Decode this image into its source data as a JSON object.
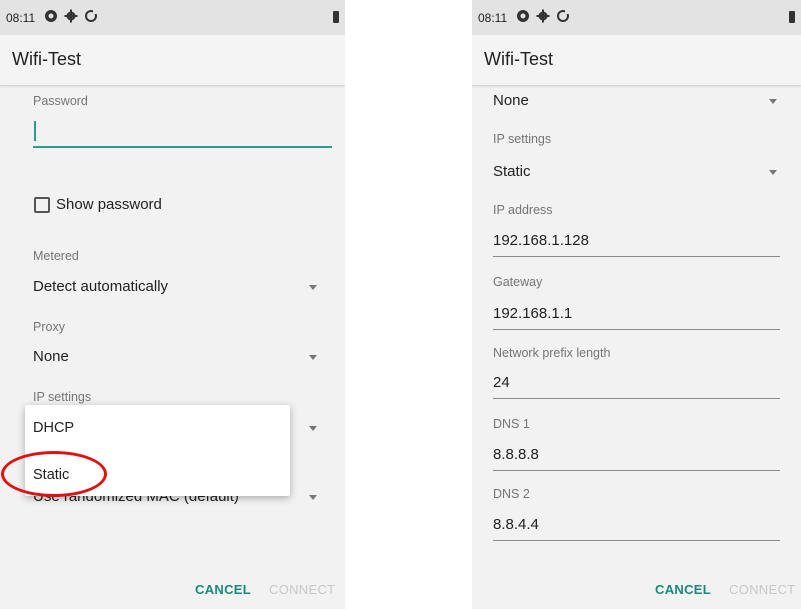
{
  "left_screen": {
    "status": {
      "time": "08:11",
      "icons": [
        "data-saver-icon",
        "settings-icon",
        "sync-icon"
      ],
      "battery_icon": "battery-icon"
    },
    "title": "Wifi-Test",
    "password_label": "Password",
    "password_value": "",
    "show_password_label": "Show password",
    "show_password_checked": false,
    "metered_label": "Metered",
    "metered_value": "Detect automatically",
    "proxy_label": "Proxy",
    "proxy_value": "None",
    "ip_settings_label": "IP settings",
    "privacy_value": "Use randomized MAC (default)",
    "dropdown_options": [
      "DHCP",
      "Static"
    ],
    "cancel_label": "CANCEL",
    "connect_label": "CONNECT",
    "highlight_color": "#e41010"
  },
  "right_screen": {
    "status": {
      "time": "08:11",
      "icons": [
        "data-saver-icon",
        "settings-icon",
        "sync-icon"
      ],
      "battery_icon": "battery-icon"
    },
    "title": "Wifi-Test",
    "proxy_value": "None",
    "ip_settings_label": "IP settings",
    "ip_settings_value": "Static",
    "ip_address_label": "IP address",
    "ip_address_value": "192.168.1.128",
    "gateway_label": "Gateway",
    "gateway_value": "192.168.1.1",
    "prefix_label": "Network prefix length",
    "prefix_value": "24",
    "dns1_label": "DNS 1",
    "dns1_value": "8.8.8.8",
    "dns2_label": "DNS 2",
    "dns2_value": "8.8.4.4",
    "cancel_label": "CANCEL",
    "connect_label": "CONNECT"
  },
  "colors": {
    "accent": "#2a9d8f",
    "cancel": "#1a8a7a",
    "disabled": "#c7c7c7"
  }
}
